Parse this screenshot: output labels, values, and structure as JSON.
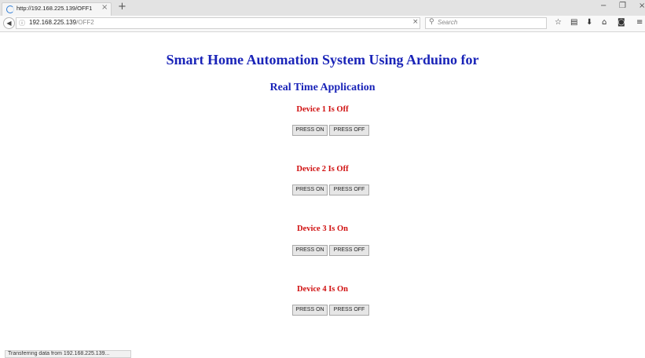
{
  "browser": {
    "tab": {
      "title": "http://192.168.225.139/OFF1",
      "close": "×"
    },
    "new_tab": "+",
    "window_controls": {
      "minimize": "−",
      "restore": "❐",
      "close": "×"
    },
    "url": {
      "host": "192.168.225.139",
      "path": "/OFF2",
      "clear": "×"
    },
    "search": {
      "placeholder": "Search"
    },
    "toolbar_icons": [
      "star-icon",
      "library-icon",
      "download-icon",
      "home-icon",
      "pocket-icon",
      "menu-icon"
    ],
    "status": "Transferring data from 192.168.225.139..."
  },
  "page": {
    "title": "Smart Home Automation System Using Arduino for",
    "subtitle": "Real Time Application",
    "devices": [
      {
        "status": "Device 1 Is Off",
        "on_label": "PRESS ON",
        "off_label": "PRESS OFF"
      },
      {
        "status": "Device 2 Is Off",
        "on_label": "PRESS ON",
        "off_label": "PRESS OFF"
      },
      {
        "status": "Device 3 Is On",
        "on_label": "PRESS ON",
        "off_label": "PRESS OFF"
      },
      {
        "status": "Device 4 Is On",
        "on_label": "PRESS ON",
        "off_label": "PRESS OFF"
      }
    ]
  },
  "colors": {
    "heading": "#1a24b8",
    "device_status": "#d01010"
  }
}
